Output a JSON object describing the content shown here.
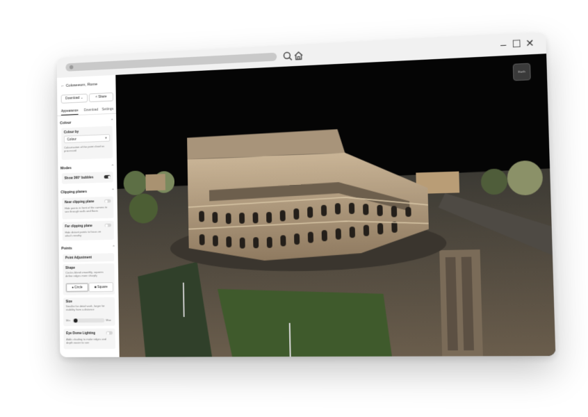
{
  "breadcrumb": {
    "title": "Coloseeum, Rome"
  },
  "actions": {
    "download_label": "Download",
    "share_label": "Share"
  },
  "tabs": [
    {
      "label": "Appearance",
      "active": true
    },
    {
      "label": "Download",
      "active": false
    },
    {
      "label": "Settings",
      "active": false
    }
  ],
  "colour": {
    "heading": "Colour",
    "colour_by_label": "Colour by",
    "selected": "Colour",
    "help": "Colourisation of the point cloud as processed"
  },
  "modes": {
    "heading": "Modes",
    "show_bubbles_label": "Show 360° bubbles",
    "show_bubbles_on": true
  },
  "clipping": {
    "heading": "Clipping planes",
    "near_label": "Near clipping plane",
    "near_help": "Hide points in front of the camera to see through walls and floors",
    "near_on": false,
    "far_label": "Far clipping plane",
    "far_help": "Hide distant points to focus on what's nearby",
    "far_on": false
  },
  "points": {
    "heading": "Points",
    "adjustment_label": "Point Adjustment",
    "shape_label": "Shape",
    "shape_help": "Circles blend smoothly, squares define edges more sharply",
    "shape_options": [
      "Circle",
      "Square"
    ],
    "shape_selected": "Circle",
    "size_label": "Size",
    "size_help": "Smaller for detail work, larger for visibility from a distance",
    "size_min_label": "Min",
    "size_max_label": "Max",
    "size_value_fraction": 0.05,
    "edl_label": "Eye Dome Lighting",
    "edl_help": "Adds shading to make edges and depth easier to see",
    "edl_on": false
  },
  "viewport": {
    "nav_button_label": "Earth"
  },
  "colors": {
    "accent": "#222222",
    "viewport_bg": "#050505",
    "stone": "#b9a487",
    "grass": "#3f5a2c"
  }
}
